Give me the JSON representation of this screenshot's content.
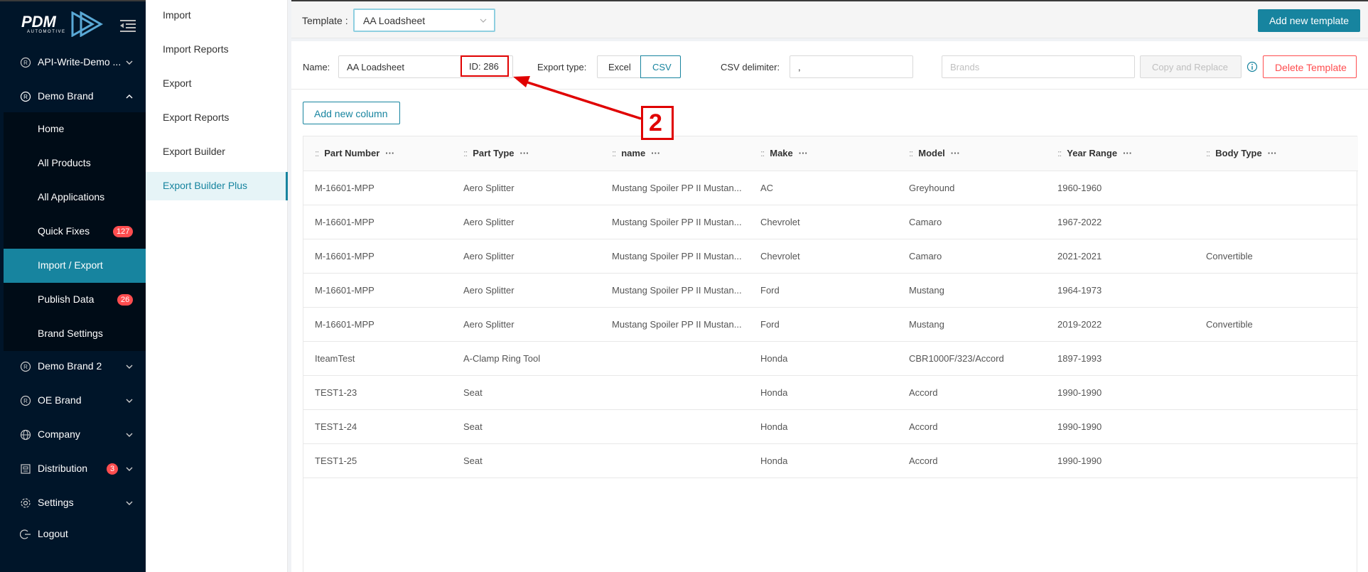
{
  "logo": {
    "text": "PDM",
    "subtext": "AUTOMOTIVE"
  },
  "sidebar": {
    "items": [
      {
        "label": "API-Write-Demo ..."
      },
      {
        "label": "Demo Brand"
      },
      {
        "label": "Demo Brand 2"
      },
      {
        "label": "OE Brand"
      },
      {
        "label": "Company"
      },
      {
        "label": "Distribution",
        "badge": "3"
      },
      {
        "label": "Settings"
      },
      {
        "label": "Logout"
      }
    ],
    "submenu": [
      {
        "label": "Home"
      },
      {
        "label": "All Products"
      },
      {
        "label": "All Applications"
      },
      {
        "label": "Quick Fixes",
        "badge": "127"
      },
      {
        "label": "Import / Export"
      },
      {
        "label": "Publish Data",
        "badge": "26"
      },
      {
        "label": "Brand Settings"
      }
    ]
  },
  "subnav": {
    "items": [
      {
        "label": "Import"
      },
      {
        "label": "Import Reports"
      },
      {
        "label": "Export"
      },
      {
        "label": "Export Reports"
      },
      {
        "label": "Export Builder"
      },
      {
        "label": "Export Builder Plus"
      }
    ]
  },
  "header": {
    "template_label": "Template :",
    "template_value": "AA Loadsheet",
    "add_template": "Add new template"
  },
  "form": {
    "name_label": "Name:",
    "name_value": "AA Loadsheet",
    "id_text": "ID: 286",
    "export_type_label": "Export type:",
    "excel": "Excel",
    "csv": "CSV",
    "csv_delim_label": "CSV delimiter:",
    "csv_delim_value": ",",
    "brands_placeholder": "Brands",
    "copy_replace": "Copy and Replace",
    "delete_template": "Delete Template",
    "add_column": "Add new column"
  },
  "annotation": {
    "number": "2"
  },
  "table": {
    "columns": [
      "Part Number",
      "Part Type",
      "name",
      "Make",
      "Model",
      "Year Range",
      "Body Type"
    ],
    "drag_glyph": "::",
    "more_glyph": "···",
    "rows": [
      [
        "M-16601-MPP",
        "Aero Splitter",
        "Mustang Spoiler PP II Mustan...",
        "AC",
        "Greyhound",
        "1960-1960",
        ""
      ],
      [
        "M-16601-MPP",
        "Aero Splitter",
        "Mustang Spoiler PP II Mustan...",
        "Chevrolet",
        "Camaro",
        "1967-2022",
        ""
      ],
      [
        "M-16601-MPP",
        "Aero Splitter",
        "Mustang Spoiler PP II Mustan...",
        "Chevrolet",
        "Camaro",
        "2021-2021",
        "Convertible"
      ],
      [
        "M-16601-MPP",
        "Aero Splitter",
        "Mustang Spoiler PP II Mustan...",
        "Ford",
        "Mustang",
        "1964-1973",
        ""
      ],
      [
        "M-16601-MPP",
        "Aero Splitter",
        "Mustang Spoiler PP II Mustan...",
        "Ford",
        "Mustang",
        "2019-2022",
        "Convertible"
      ],
      [
        "IteamTest",
        "A-Clamp Ring Tool",
        "",
        "Honda",
        "CBR1000F/323/Accord",
        "1897-1993",
        ""
      ],
      [
        "TEST1-23",
        "Seat",
        "",
        "Honda",
        "Accord",
        "1990-1990",
        ""
      ],
      [
        "TEST1-24",
        "Seat",
        "",
        "Honda",
        "Accord",
        "1990-1990",
        ""
      ],
      [
        "TEST1-25",
        "Seat",
        "",
        "Honda",
        "Accord",
        "1990-1990",
        ""
      ]
    ]
  },
  "colors": {
    "accent": "#17849f",
    "sidebar_bg": "#001529",
    "danger": "#ff4d4f",
    "annotation": "#e00000"
  }
}
